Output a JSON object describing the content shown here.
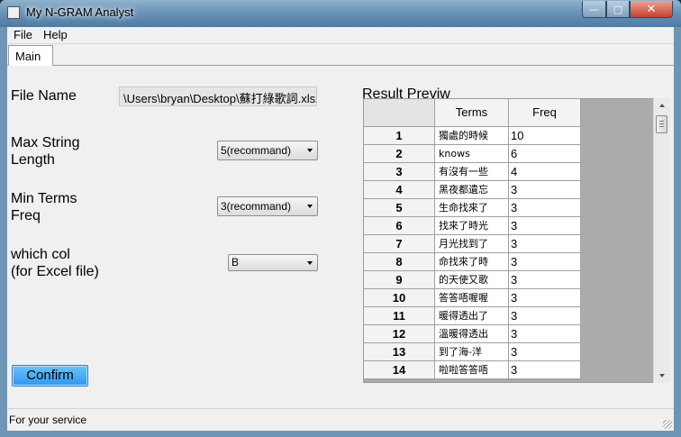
{
  "window": {
    "title": "My N-GRAM Analyst",
    "controls": {
      "minimize": "—",
      "maximize": "□",
      "close": "✕"
    }
  },
  "menu": {
    "file": "File",
    "help": "Help"
  },
  "tabs": {
    "main": "Main"
  },
  "form": {
    "file_name_label": "File Name",
    "file_path": "\\Users\\bryan\\Desktop\\蘇打綠歌詞.xlsx",
    "max_string_label_1": "Max String",
    "max_string_label_2": "Length",
    "max_string_value": "5(recommand)",
    "min_terms_label_1": "Min Terms",
    "min_terms_label_2": "Freq",
    "min_terms_value": "3(recommand)",
    "which_col_label_1": "which col",
    "which_col_label_2": "(for Excel file)",
    "which_col_value": "B",
    "confirm_label": "Confirm"
  },
  "result": {
    "title": "Result Previw",
    "columns": [
      "",
      "Terms",
      "Freq"
    ],
    "rows": [
      {
        "n": "1",
        "term": "獨處的時候",
        "freq": "10"
      },
      {
        "n": "2",
        "term": "knows",
        "freq": "6"
      },
      {
        "n": "3",
        "term": "有沒有一些",
        "freq": "4"
      },
      {
        "n": "4",
        "term": "黑夜都遺忘",
        "freq": "3"
      },
      {
        "n": "5",
        "term": "生命找來了",
        "freq": "3"
      },
      {
        "n": "6",
        "term": "找來了時光",
        "freq": "3"
      },
      {
        "n": "7",
        "term": "月光找到了",
        "freq": "3"
      },
      {
        "n": "8",
        "term": "命找來了時",
        "freq": "3"
      },
      {
        "n": "9",
        "term": "的天使又歌",
        "freq": "3"
      },
      {
        "n": "10",
        "term": "答答唔喔喔",
        "freq": "3"
      },
      {
        "n": "11",
        "term": "暖得透出了",
        "freq": "3"
      },
      {
        "n": "12",
        "term": "溫暖得透出",
        "freq": "3"
      },
      {
        "n": "13",
        "term": "到了海-洋",
        "freq": "3"
      },
      {
        "n": "14",
        "term": "啦啦答答唔",
        "freq": "3"
      }
    ]
  },
  "status": {
    "text": "For your service"
  }
}
